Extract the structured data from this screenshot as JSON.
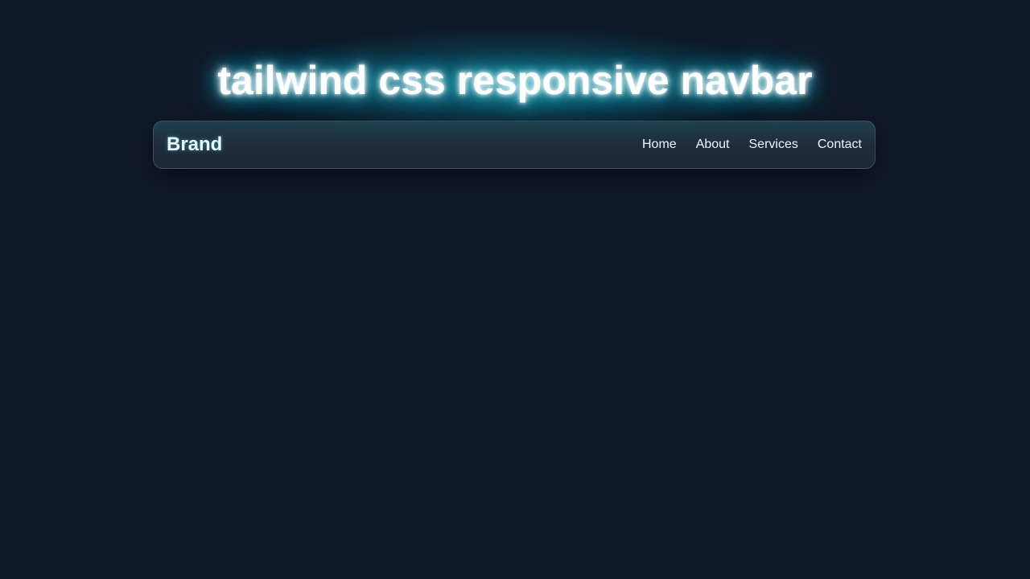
{
  "header": {
    "title": "tailwind css responsive navbar"
  },
  "navbar": {
    "brand": "Brand",
    "links": [
      {
        "label": "Home"
      },
      {
        "label": "About"
      },
      {
        "label": "Services"
      },
      {
        "label": "Contact"
      }
    ]
  },
  "colors": {
    "background": "#111827",
    "glow": "#22d3ee",
    "text": "#f1f5f9"
  }
}
